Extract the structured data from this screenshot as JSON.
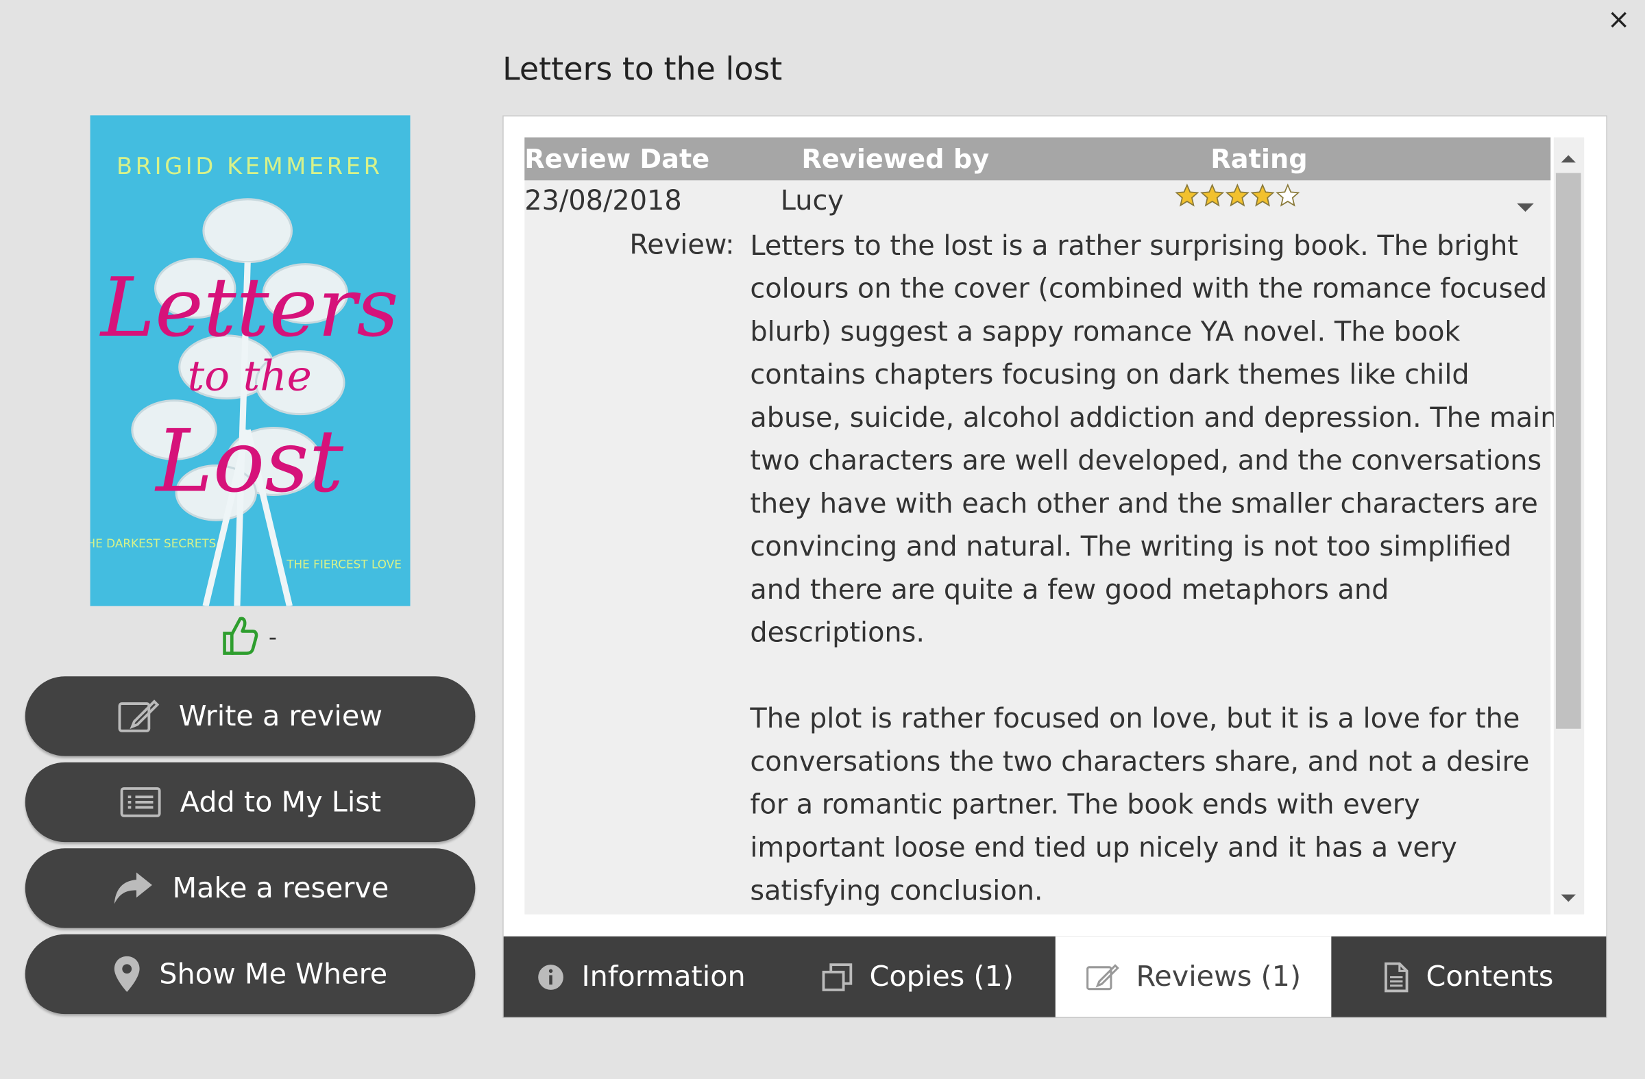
{
  "window": {
    "close_label": "×"
  },
  "book": {
    "title": "Letters to the lost"
  },
  "cover": {
    "author": "BRIGID KEMMERER",
    "title_line1": "Letters",
    "title_line2": "to the",
    "title_line3": "Lost",
    "tagline_left": "THE DARKEST SECRETS",
    "tagline_right": "THE FIERCEST LOVE"
  },
  "likes": {
    "count": "-"
  },
  "actions": [
    {
      "label": "Write a review",
      "icon": "edit-icon"
    },
    {
      "label": "Add to My List",
      "icon": "list-icon"
    },
    {
      "label": "Make a reserve",
      "icon": "share-arrow-icon"
    },
    {
      "label": "Show Me Where",
      "icon": "map-pin-icon"
    }
  ],
  "reviews": {
    "columns": [
      "Review Date",
      "Reviewed by",
      "Rating"
    ],
    "rows": [
      {
        "date": "23/08/2018",
        "reviewer": "Lucy",
        "rating": 4,
        "rating_max": 5,
        "review_label": "Review:",
        "paragraphs": [
          "Letters to the lost is a rather surprising book. The bright colours on the cover (combined with the romance focused blurb) suggest a sappy romance YA novel. The book contains chapters focusing on dark themes like child abuse, suicide, alcohol addiction and depression. The main two characters are well developed, and the conversations they have with each other and the smaller characters are convincing and natural. The writing is not too simplified and there are quite a few good metaphors and descriptions.",
          "The plot is rather focused on love, but it is a love for the conversations the two characters share, and not a desire for a romantic partner. The book ends with every important loose end tied up nicely and it has a very satisfying conclusion."
        ]
      }
    ]
  },
  "tabs": [
    {
      "label": "Information",
      "icon": "info-icon",
      "active": false
    },
    {
      "label": "Copies (1)",
      "icon": "copies-icon",
      "active": false
    },
    {
      "label": "Reviews (1)",
      "icon": "edit-icon",
      "active": true
    },
    {
      "label": "Contents",
      "icon": "document-icon",
      "active": false
    }
  ],
  "colors": {
    "background": "#e3e3e3",
    "button": "#424242",
    "tab_bar": "#3f3f3f",
    "header": "#a6a6a6",
    "star": "#f2c12e",
    "like": "#2e9e2e",
    "cover_bg": "#43bde0",
    "cover_title": "#d6127a"
  }
}
